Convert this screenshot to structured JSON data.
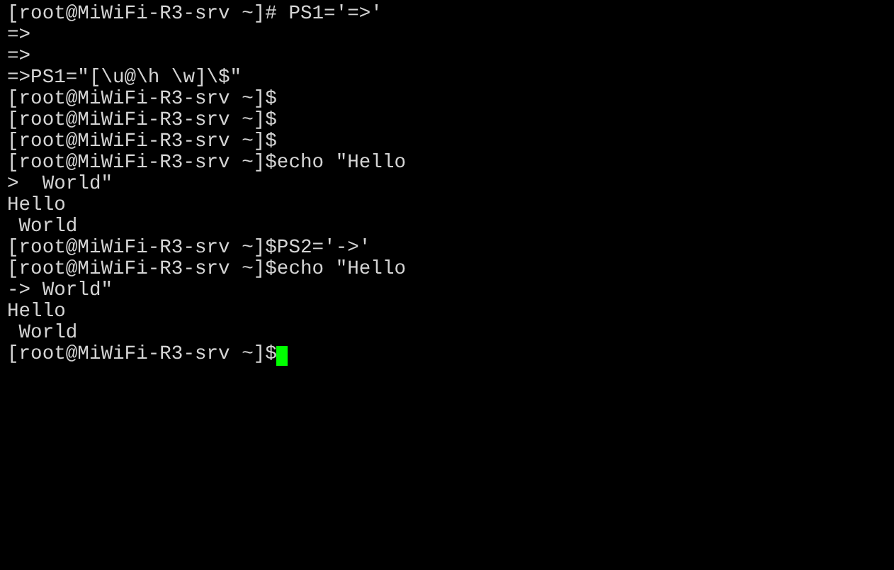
{
  "terminal": {
    "lines": [
      {
        "text": "[root@MiWiFi-R3-srv ~]# PS1='=>'",
        "cursor": false
      },
      {
        "text": "=>",
        "cursor": false
      },
      {
        "text": "=>",
        "cursor": false
      },
      {
        "text": "=>PS1=\"[\\u@\\h \\w]\\$\"",
        "cursor": false
      },
      {
        "text": "[root@MiWiFi-R3-srv ~]$",
        "cursor": false
      },
      {
        "text": "[root@MiWiFi-R3-srv ~]$",
        "cursor": false
      },
      {
        "text": "[root@MiWiFi-R3-srv ~]$",
        "cursor": false
      },
      {
        "text": "[root@MiWiFi-R3-srv ~]$echo \"Hello",
        "cursor": false
      },
      {
        "text": ">  World\"",
        "cursor": false
      },
      {
        "text": "Hello",
        "cursor": false
      },
      {
        "text": " World",
        "cursor": false
      },
      {
        "text": "[root@MiWiFi-R3-srv ~]$PS2='->'",
        "cursor": false
      },
      {
        "text": "[root@MiWiFi-R3-srv ~]$echo \"Hello",
        "cursor": false
      },
      {
        "text": "-> World\"",
        "cursor": false
      },
      {
        "text": "Hello",
        "cursor": false
      },
      {
        "text": " World",
        "cursor": false
      },
      {
        "text": "[root@MiWiFi-R3-srv ~]$",
        "cursor": true
      }
    ]
  }
}
